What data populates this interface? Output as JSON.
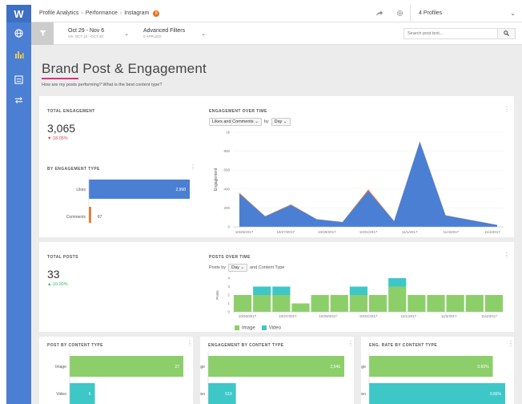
{
  "colors": {
    "sidebar": "#4a7fd4",
    "accent_pink": "#d63384",
    "bar_blue": "#4a7fd4",
    "bar_orange": "#e8711c",
    "bar_green": "#8ccf6a",
    "bar_teal": "#3ec7c7"
  },
  "sidebar": {
    "logo": "W",
    "items": [
      {
        "icon": "globe-icon"
      },
      {
        "icon": "bar-chart-icon"
      },
      {
        "icon": "report-icon"
      },
      {
        "icon": "transfer-icon"
      }
    ]
  },
  "header": {
    "breadcrumb": [
      "Profile Analytics",
      "Performance",
      "Instagram"
    ],
    "badge": "8",
    "profiles_label": "4 Profiles"
  },
  "filters": {
    "date_main": "Oct 29 - Nov 6",
    "date_sub": "VS. OCT 18 - OCT 28",
    "advanced_main": "Advanced Filters",
    "advanced_sub": "0 APPLIED",
    "search_placeholder": "Search post text..."
  },
  "page": {
    "title": "Brand Post & Engagement",
    "subtitle": "How are my posts performing? What is the best content type?"
  },
  "total_engagement": {
    "label": "TOTAL ENGAGEMENT",
    "value": "3,065",
    "delta": "▼ 18.05%"
  },
  "by_engagement_type": {
    "label": "BY ENGAGEMENT TYPE",
    "chart_data": {
      "type": "bar",
      "categories": [
        "Likes",
        "Comments"
      ],
      "values": [
        2998,
        67
      ],
      "value_labels": [
        "2,998",
        "67"
      ],
      "colors": [
        "#4a7fd4",
        "#e8711c"
      ]
    }
  },
  "engagement_over_time": {
    "label": "ENGAGEMENT OVER TIME",
    "metric_select": "Likes and Comments",
    "by_text": "by",
    "period_select": "Day",
    "chart_data": {
      "type": "area",
      "ylabel": "Engagement",
      "ylim": [
        0,
        1000
      ],
      "y_ticks": [
        0,
        200,
        400,
        600,
        800,
        "1k"
      ],
      "x_labels": [
        "10/26/2017",
        "10/27/2017",
        "10/29/2017",
        "10/31/2017",
        "11/1/2017",
        "11/4/2017",
        "11/4/2017"
      ],
      "series": [
        {
          "name": "Likes",
          "color": "#4a7fd4",
          "values": [
            350,
            110,
            230,
            80,
            50,
            380,
            60,
            900,
            120,
            70,
            20
          ]
        },
        {
          "name": "Comments",
          "color": "#e8711c",
          "values": [
            10,
            3,
            7,
            2,
            2,
            15,
            3,
            5,
            3,
            2,
            1
          ]
        }
      ]
    }
  },
  "total_posts": {
    "label": "TOTAL POSTS",
    "value": "33",
    "delta": "▲ 10.00%"
  },
  "posts_over_time": {
    "label": "POSTS OVER TIME",
    "posts_by_text": "Posts by",
    "period_select": "Day",
    "content_text": "and Content Type",
    "chart_data": {
      "type": "bar",
      "stacked": true,
      "ylabel": "Posts",
      "ylim": [
        0,
        4
      ],
      "y_ticks": [
        0,
        1,
        2,
        3,
        4
      ],
      "x_labels": [
        "10/26/2017",
        "10/27/2017",
        "10/29/2017",
        "10/31/2017",
        "11/1/2017",
        "11/3/2017",
        "11/4/2017"
      ],
      "series": [
        {
          "name": "Image",
          "color": "#8ccf6a",
          "values": [
            2,
            2,
            2,
            1,
            2,
            2,
            2,
            2,
            3,
            2,
            2,
            2,
            2,
            2
          ]
        },
        {
          "name": "Video",
          "color": "#3ec7c7",
          "values": [
            0,
            1,
            1,
            0,
            0,
            0,
            1,
            0,
            1,
            0,
            0,
            0,
            0,
            0
          ]
        }
      ],
      "legend": [
        "Image",
        "Video"
      ]
    }
  },
  "post_by_content_type": {
    "label": "POST BY CONTENT TYPE",
    "chart_data": {
      "type": "bar",
      "categories": [
        "Image",
        "Video"
      ],
      "values": [
        27,
        6
      ],
      "value_labels": [
        "27",
        "6"
      ],
      "colors": [
        "#8ccf6a",
        "#3ec7c7"
      ]
    }
  },
  "engagement_by_content_type": {
    "label": "ENGAGEMENT BY CONTENT TYPE",
    "chart_data": {
      "type": "bar",
      "categories": [
        "Image",
        "Video"
      ],
      "values": [
        2546,
        519
      ],
      "value_labels": [
        "2,546",
        "519"
      ],
      "colors": [
        "#8ccf6a",
        "#3ec7c7"
      ]
    }
  },
  "eng_rate_by_content_type": {
    "label": "ENG. RATE BY CONTENT TYPE",
    "chart_data": {
      "type": "bar",
      "categories": [
        "Image",
        "Video"
      ],
      "values": [
        0.6,
        0.66
      ],
      "value_labels": [
        "0.60%",
        "0.66%"
      ],
      "colors": [
        "#8ccf6a",
        "#3ec7c7"
      ]
    }
  }
}
